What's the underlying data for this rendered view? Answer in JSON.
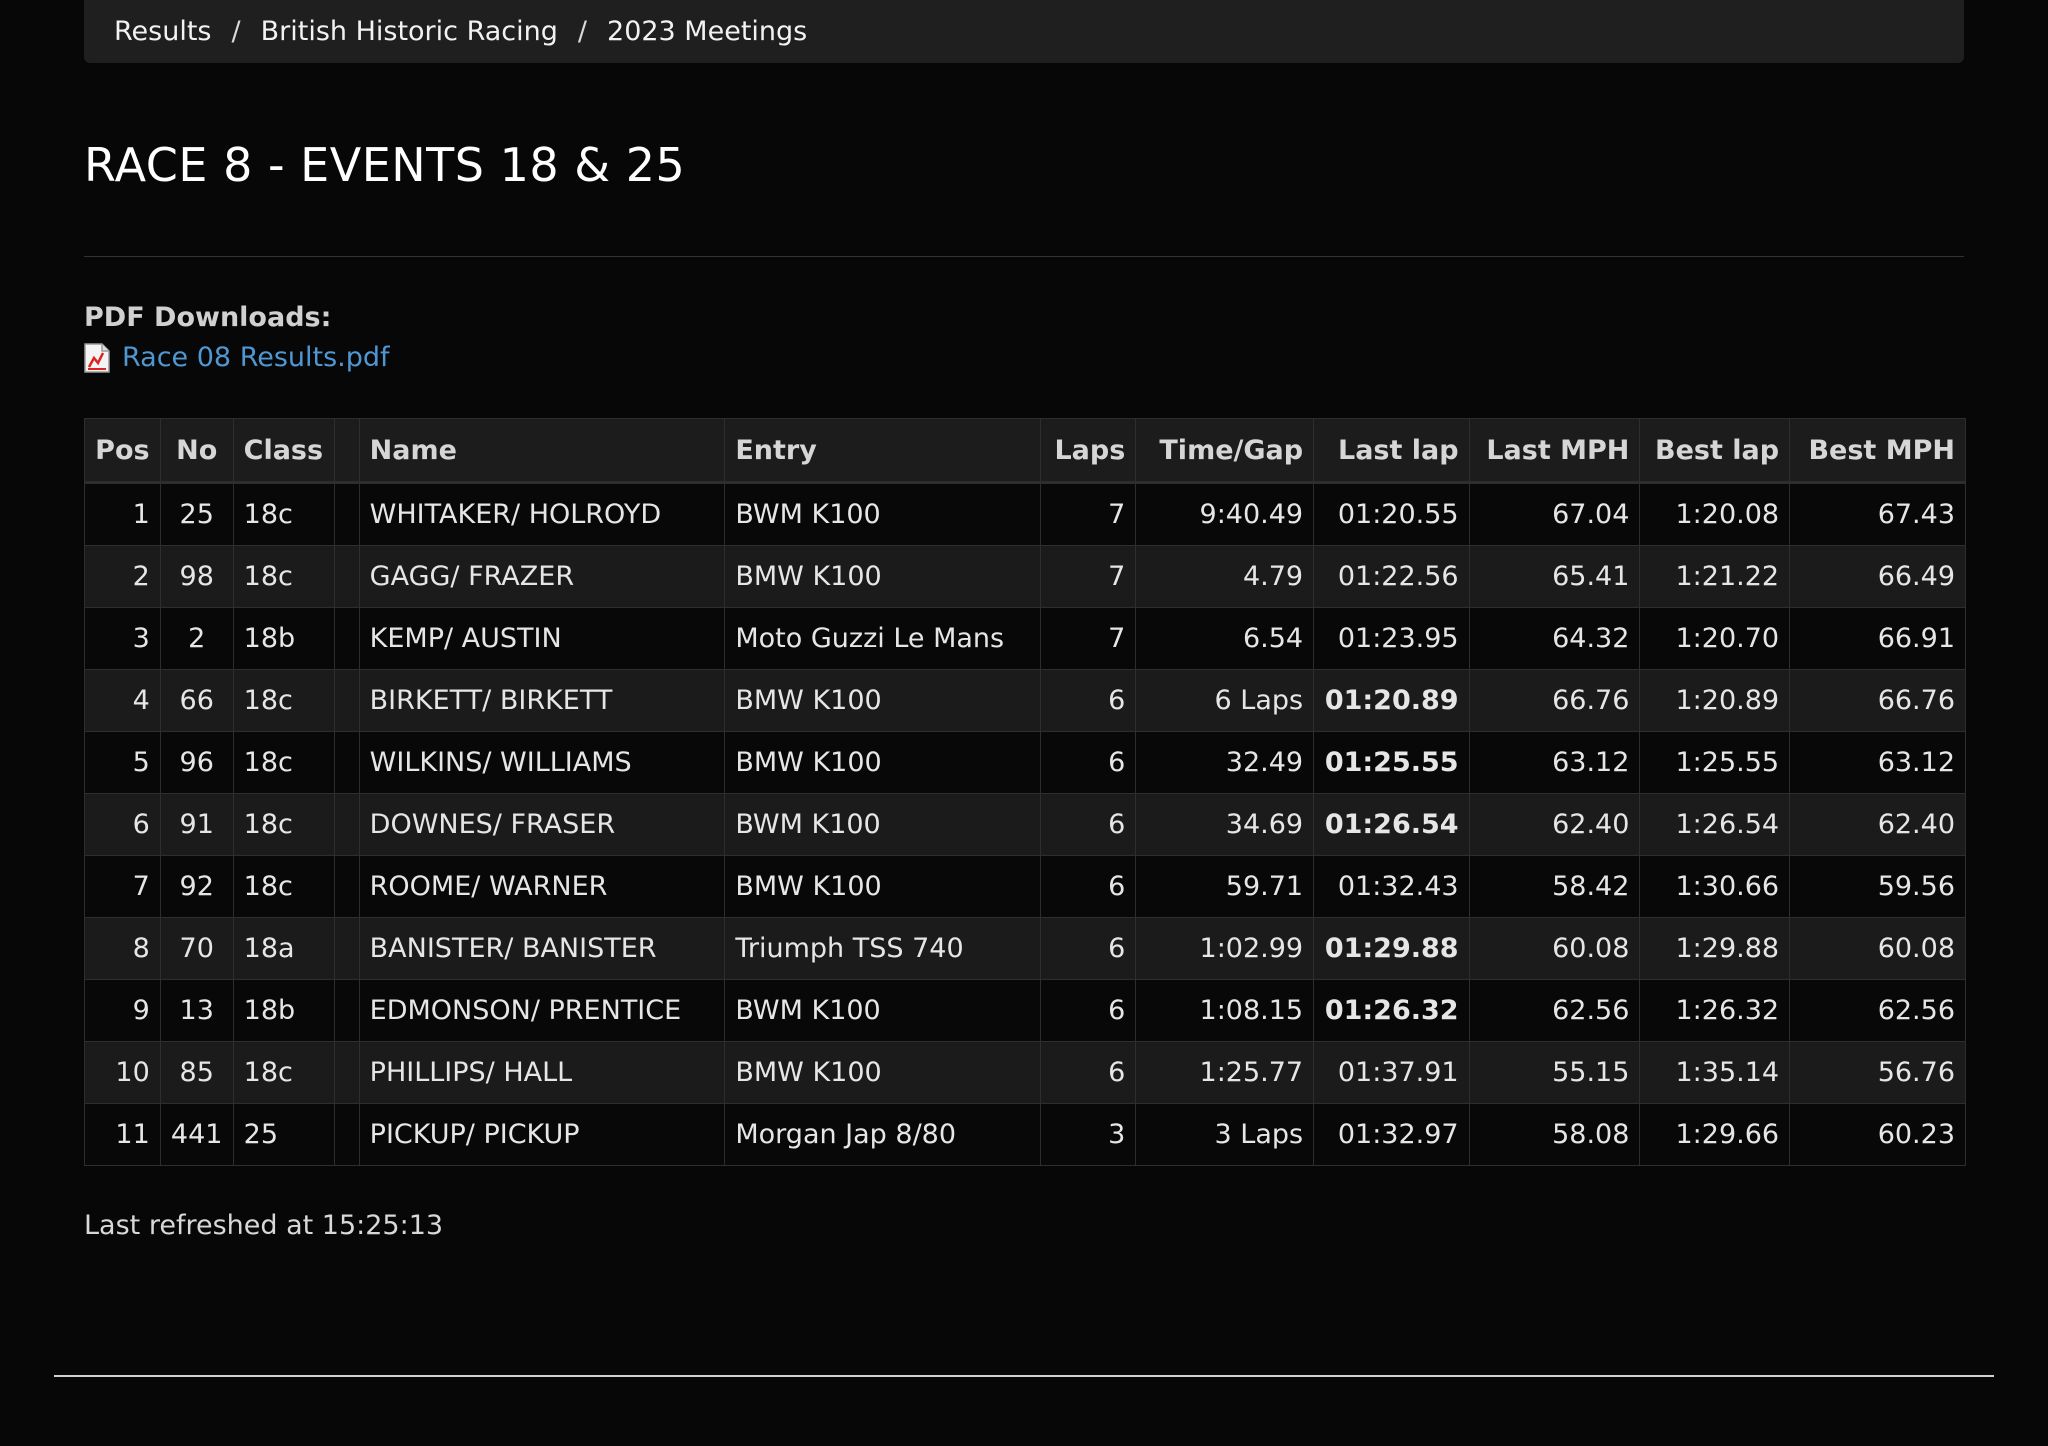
{
  "breadcrumb": {
    "items": [
      "Results",
      "British Historic Racing",
      "2023 Meetings"
    ],
    "separator": "/"
  },
  "page_title": "RACE 8 - EVENTS 18 & 25",
  "downloads": {
    "label": "PDF Downloads:",
    "file": "Race 08 Results.pdf",
    "icon": "pdf-file-icon"
  },
  "table": {
    "headers": [
      "Pos",
      "No",
      "Class",
      "",
      "Name",
      "Entry",
      "Laps",
      "Time/Gap",
      "Last lap",
      "Last MPH",
      "Best lap",
      "Best MPH"
    ],
    "rows": [
      [
        "1",
        "25",
        "18c",
        "",
        "WHITAKER/ HOLROYD",
        "BWM K100",
        "7",
        "9:40.49",
        "01:20.55",
        "67.04",
        "1:20.08",
        "67.43"
      ],
      [
        "2",
        "98",
        "18c",
        "",
        "GAGG/ FRAZER",
        "BMW K100",
        "7",
        "4.79",
        "01:22.56",
        "65.41",
        "1:21.22",
        "66.49"
      ],
      [
        "3",
        "2",
        "18b",
        "",
        "KEMP/ AUSTIN",
        "Moto Guzzi Le Mans",
        "7",
        "6.54",
        "01:23.95",
        "64.32",
        "1:20.70",
        "66.91"
      ],
      [
        "4",
        "66",
        "18c",
        "",
        "BIRKETT/ BIRKETT",
        "BMW K100",
        "6",
        "6 Laps",
        "01:20.89",
        "66.76",
        "1:20.89",
        "66.76"
      ],
      [
        "5",
        "96",
        "18c",
        "",
        "WILKINS/ WILLIAMS",
        "BMW K100",
        "6",
        "32.49",
        "01:25.55",
        "63.12",
        "1:25.55",
        "63.12"
      ],
      [
        "6",
        "91",
        "18c",
        "",
        "DOWNES/ FRASER",
        "BWM K100",
        "6",
        "34.69",
        "01:26.54",
        "62.40",
        "1:26.54",
        "62.40"
      ],
      [
        "7",
        "92",
        "18c",
        "",
        "ROOME/ WARNER",
        "BMW K100",
        "6",
        "59.71",
        "01:32.43",
        "58.42",
        "1:30.66",
        "59.56"
      ],
      [
        "8",
        "70",
        "18a",
        "",
        "BANISTER/ BANISTER",
        "Triumph TSS 740",
        "6",
        "1:02.99",
        "01:29.88",
        "60.08",
        "1:29.88",
        "60.08"
      ],
      [
        "9",
        "13",
        "18b",
        "",
        "EDMONSON/ PRENTICE",
        "BWM K100",
        "6",
        "1:08.15",
        "01:26.32",
        "62.56",
        "1:26.32",
        "62.56"
      ],
      [
        "10",
        "85",
        "18c",
        "",
        "PHILLIPS/ HALL",
        "BMW K100",
        "6",
        "1:25.77",
        "01:37.91",
        "55.15",
        "1:35.14",
        "56.76"
      ],
      [
        "11",
        "441",
        "25",
        "",
        "PICKUP/ PICKUP",
        "Morgan Jap 8/80",
        "3",
        "3 Laps",
        "01:32.97",
        "58.08",
        "1:29.66",
        "60.23"
      ]
    ],
    "highlight_personal_best_last_lap_rows": [
      3,
      4,
      5,
      7,
      8
    ],
    "highlight_overall_best_lap_row": 0
  },
  "colors": {
    "personal_best": "#55d93a",
    "overall_best": "#e040e0",
    "link": "#4f97d3"
  },
  "refreshed_text": "Last refreshed at 15:25:13"
}
